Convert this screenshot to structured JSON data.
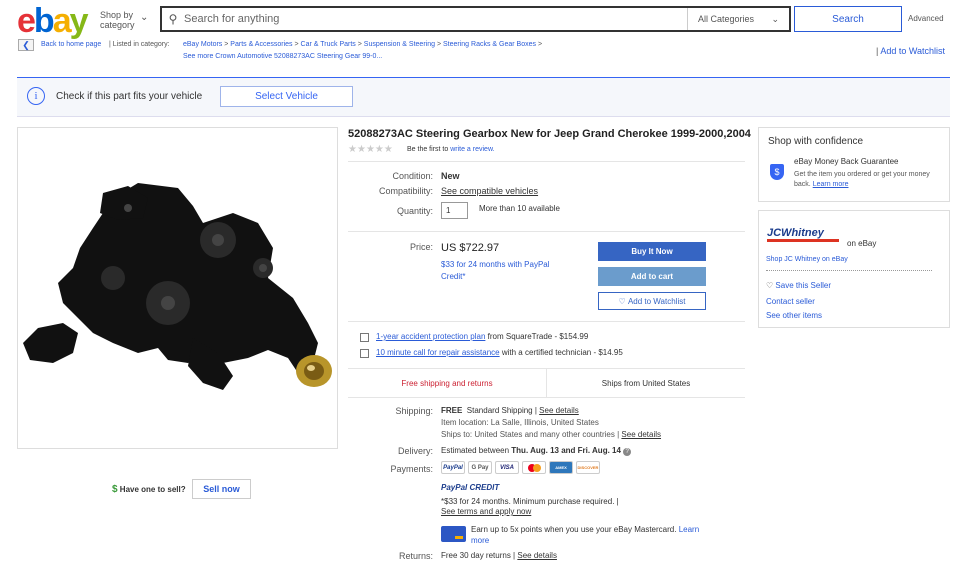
{
  "header": {
    "logo_letters": [
      "e",
      "b",
      "a",
      "y"
    ],
    "shop_by_line1": "Shop by",
    "shop_by_line2": "category",
    "search_placeholder": "Search for anything",
    "category_select": "All Categories",
    "search_button": "Search",
    "advanced_link": "Advanced"
  },
  "breadcrumb": {
    "back_label": "Back to home page",
    "listed_in": "| Listed in category:",
    "items": [
      "eBay Motors",
      "Parts & Accessories",
      "Car & Truck Parts",
      "Suspension & Steering",
      "Steering Racks & Gear Boxes"
    ],
    "separator": ">",
    "more": "See more Crown Automotive 52088273AC Steering Gear 99-0...",
    "watchlist_top": "Add to Watchlist"
  },
  "fits_banner": {
    "text": "Check if this part fits your vehicle",
    "button": "Select Vehicle"
  },
  "sell": {
    "text": "Have one to sell?",
    "button": "Sell now"
  },
  "item": {
    "title": "52088273AC Steering Gearbox New for Jeep Grand Cherokee 1999-2000,2004",
    "review_prefix": "Be the first to",
    "review_link": "write a review.",
    "condition_label": "Condition:",
    "condition_value": "New",
    "compat_label": "Compatibility:",
    "compat_link": "See compatible vehicles",
    "qty_label": "Quantity:",
    "qty_value": "1",
    "qty_available": "More than 10 available",
    "price_label": "Price:",
    "price_value": "US $722.97",
    "ppc_line1": "$33 for 24 months with PayPal",
    "ppc_line2": "Credit*",
    "buy_now": "Buy It Now",
    "add_to_cart": "Add to cart",
    "add_to_watchlist": "Add to Watchlist"
  },
  "protection": [
    {
      "link": "1-year accident protection plan",
      "rest": " from SquareTrade - $154.99"
    },
    {
      "link": "10 minute call for repair assistance",
      "rest": " with a certified technician - $14.95"
    }
  ],
  "shipping_tabs": {
    "free": "Free shipping and returns",
    "from": "Ships from United States"
  },
  "details": {
    "shipping_label": "Shipping:",
    "shipping_free": "FREE",
    "shipping_std": "Standard Shipping |",
    "see_details": "See details",
    "location": "Item location: La Salle, Illinois, United States",
    "ships_to": "Ships to: United States and many other countries |",
    "delivery_label": "Delivery:",
    "delivery_prefix": "Estimated between",
    "delivery_dates": "Thu. Aug. 13 and Fri. Aug. 14",
    "payments_label": "Payments:",
    "pay_methods": [
      "PayPal",
      "G Pay",
      "VISA",
      "MC",
      "AMEX",
      "DISCOVER"
    ],
    "ppc_brand": "PayPal CREDIT",
    "ppc_terms": "*$33 for 24 months. Minimum purchase required.  |",
    "ppc_apply": "See terms and apply now",
    "mc_text": "Earn up to 5x points when you use your eBay Mastercard.",
    "mc_learn": "Learn",
    "mc_more": "more",
    "returns_label": "Returns:",
    "returns_text": "Free 30 day returns |"
  },
  "confidence": {
    "title": "Shop with confidence",
    "mbg_title": "eBay Money Back Guarantee",
    "mbg_text": "Get the item you ordered or get your money back.",
    "learn_more": "Learn more"
  },
  "seller": {
    "logo": "JCWhitney",
    "on_ebay": "on eBay",
    "shop_link": "Shop JC Whitney on eBay",
    "save": "Save this Seller",
    "contact": "Contact seller",
    "other": "See other items"
  },
  "colors": {
    "accent": "#3665f3",
    "buy_now": "#3665c3",
    "add_to_cart": "#6b9ccc",
    "free_shipping": "#cc2233"
  }
}
